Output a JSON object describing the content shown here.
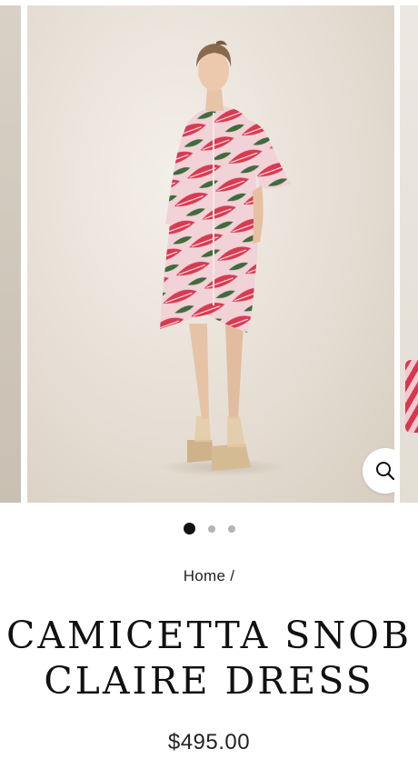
{
  "gallery": {
    "zoom_icon": "search-icon",
    "dots": [
      {
        "active": true
      },
      {
        "active": false
      },
      {
        "active": false
      }
    ]
  },
  "breadcrumb": {
    "home": "Home",
    "separator": "/"
  },
  "product": {
    "title_line1": "CAMICETTA SNOB",
    "title_line2": "CLAIRE DRESS",
    "price": "$495.00"
  },
  "colors": {
    "background": "#ffffff",
    "text": "#111111",
    "dot_active": "#111111",
    "dot_inactive": "#b4b4b4"
  }
}
